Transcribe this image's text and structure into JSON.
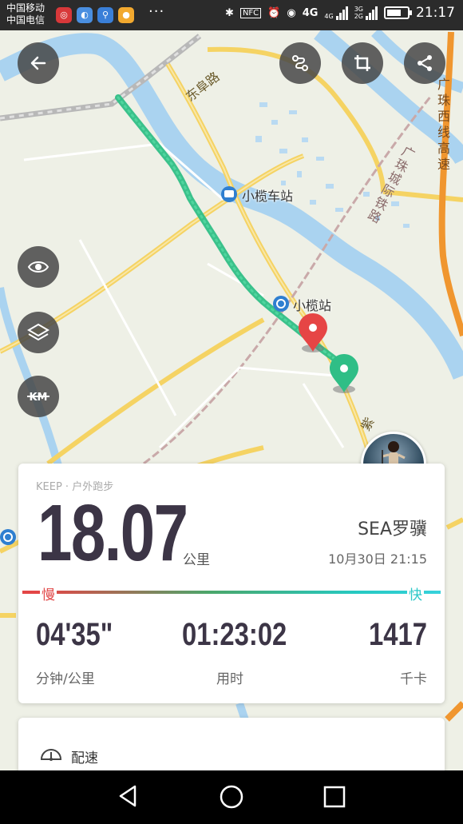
{
  "status_bar": {
    "carrier_1": "中国移动",
    "carrier_2": "中国电信",
    "more": "···",
    "nfc": "NFC",
    "network_4g": "4G",
    "network_small": "4G",
    "network_3g2g_top": "3G",
    "network_3g2g_bottom": "2G",
    "time": "21:17",
    "battery_level": 0.7
  },
  "map": {
    "labels": {
      "road_dongfu": "东阜路",
      "station_bus": "小榄车站",
      "station_rail": "小榄站",
      "railway": "广珠城际铁路",
      "expressway": "广珠西线高速",
      "road_bottom": "紫"
    },
    "buttons": {
      "back": "back",
      "route": "route",
      "crop": "crop",
      "share": "share",
      "visibility": "visibility",
      "layers": "layers",
      "km_toggle": "KM"
    }
  },
  "summary": {
    "source": "KEEP · 户外跑步",
    "distance": "18.07",
    "distance_unit": "公里",
    "user_name": "SEA罗骥",
    "date": "10月30日 21:15",
    "pace_slow": "慢",
    "pace_fast": "快",
    "pace": "04'35\"",
    "pace_label": "分钟/公里",
    "duration": "01:23:02",
    "duration_label": "用时",
    "calories": "1417",
    "calories_label": "千卡"
  },
  "section": {
    "pace_title": "配速"
  },
  "colors": {
    "route": "#2fbe86",
    "start_pin": "#e64545",
    "end_pin": "#2fbe86",
    "pace_slow": "#e24848",
    "pace_fast": "#2ac8c8"
  }
}
